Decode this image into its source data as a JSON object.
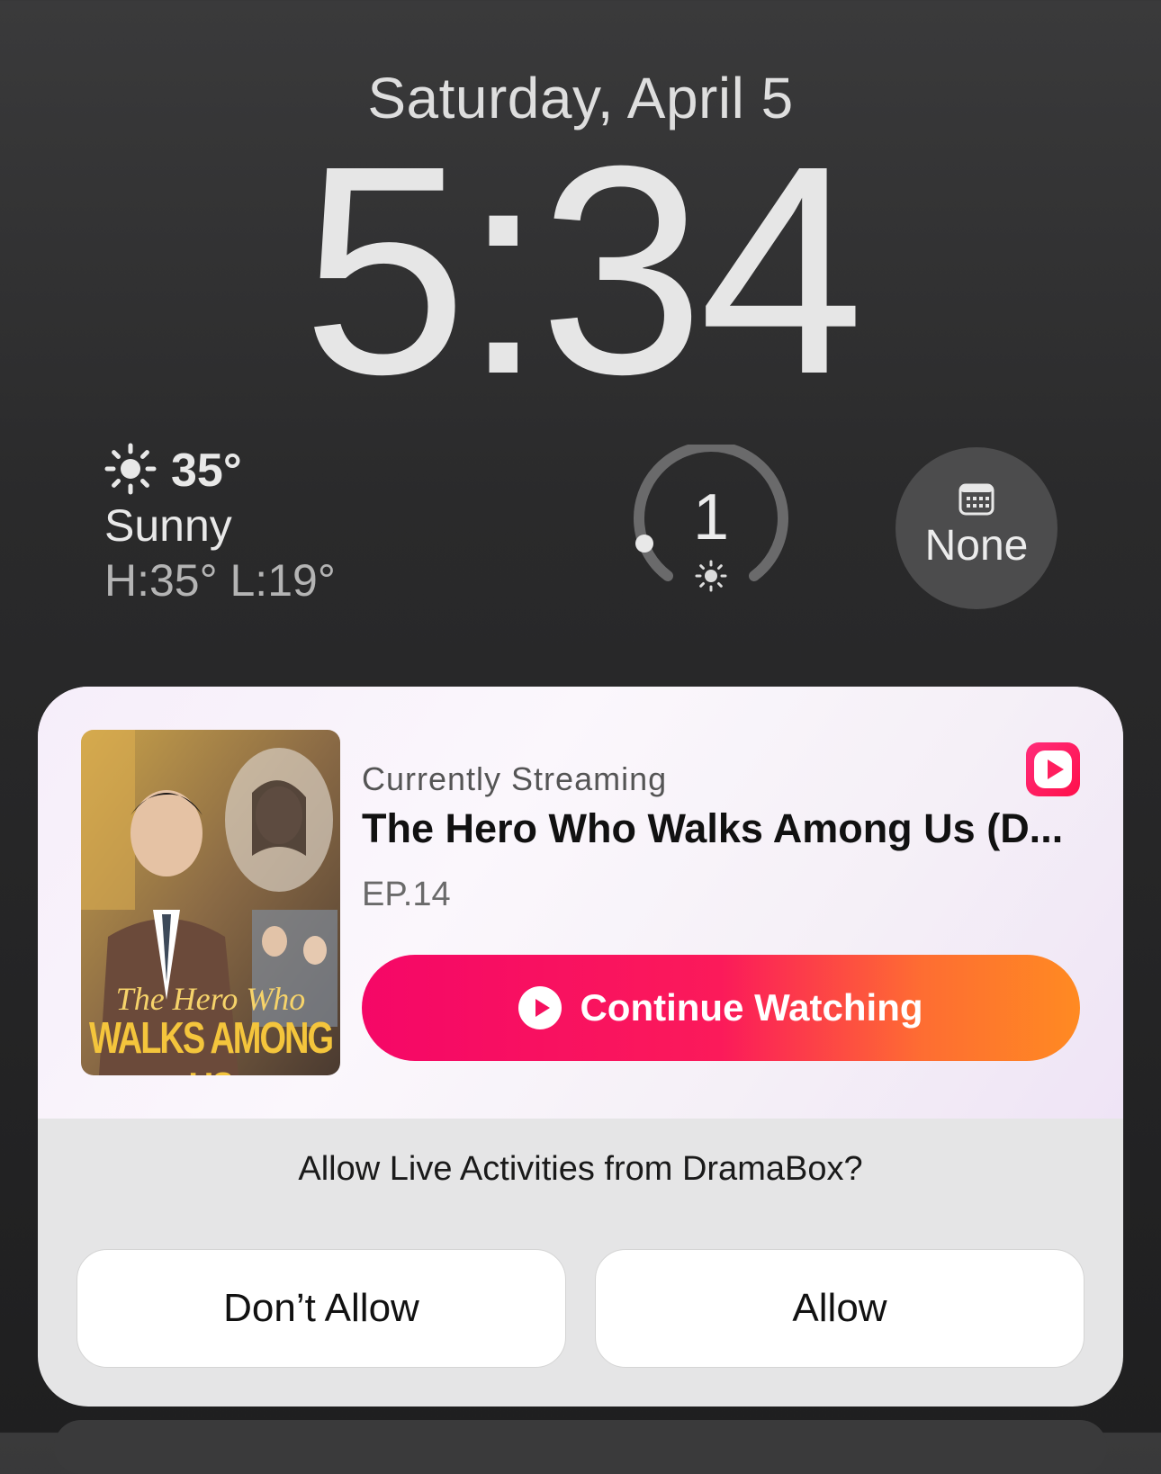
{
  "lockscreen": {
    "date": "Saturday, April 5",
    "time": "5:34"
  },
  "widgets": {
    "weather": {
      "icon": "sun-icon",
      "temperature": "35°",
      "condition": "Sunny",
      "high_low": "H:35° L:19°"
    },
    "uv_index": {
      "value": "1",
      "icon": "sun-small-icon"
    },
    "calendar": {
      "icon": "calendar-icon",
      "label": "None"
    }
  },
  "live_activity": {
    "app_icon": "dramabox-play-icon",
    "status": "Currently Streaming",
    "title": "The Hero Who Walks Among Us (D...",
    "episode": "EP.14",
    "poster_text_line1": "The Hero Who",
    "poster_text_line2": "WALKS AMONG US",
    "cta_label": "Continue Watching",
    "cta_gradient": [
      "#f50767",
      "#ff8a22"
    ]
  },
  "permission": {
    "prompt": "Allow Live Activities from DramaBox?",
    "deny_label": "Don’t Allow",
    "allow_label": "Allow"
  }
}
